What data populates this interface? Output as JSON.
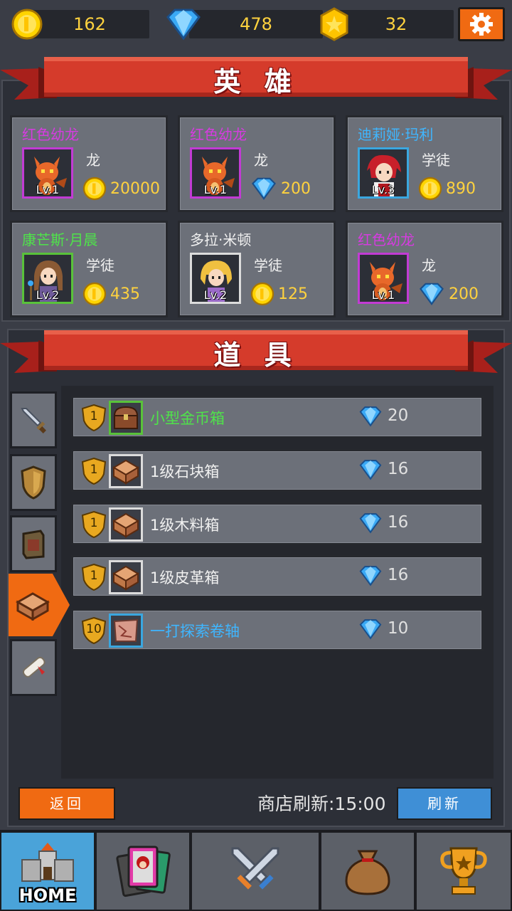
{
  "currencies": [
    {
      "icon": "gold-coin-icon",
      "value": "162"
    },
    {
      "icon": "diamond-icon",
      "value": "478"
    },
    {
      "icon": "star-coin-icon",
      "value": "32"
    }
  ],
  "heroes_section": {
    "title": "英 雄",
    "cards": [
      {
        "name": "红色幼龙",
        "name_color": "#d63be0",
        "role": "龙",
        "level": "Lv.1",
        "frame_color": "#c23bd4",
        "currency": "gold-coin-icon",
        "price": "20000",
        "portrait": "dragon"
      },
      {
        "name": "红色幼龙",
        "name_color": "#d63be0",
        "role": "龙",
        "level": "Lv.1",
        "frame_color": "#c23bd4",
        "currency": "diamond-icon",
        "price": "200",
        "portrait": "dragon"
      },
      {
        "name": "迪莉娅·玛利",
        "name_color": "#3fb6ff",
        "role": "学徒",
        "level": "Lv.3",
        "frame_color": "#3aa7e0",
        "currency": "gold-coin-icon",
        "price": "890",
        "portrait": "red-hair"
      },
      {
        "name": "康芒斯·月晨",
        "name_color": "#4fe34a",
        "role": "学徒",
        "level": "Lv.2",
        "frame_color": "#59c23a",
        "currency": "gold-coin-icon",
        "price": "435",
        "portrait": "brown-hair"
      },
      {
        "name": "多拉·米顿",
        "name_color": "#f0f0f0",
        "role": "学徒",
        "level": "Lv.2",
        "frame_color": "#dcdcdc",
        "currency": "gold-coin-icon",
        "price": "125",
        "portrait": "blonde"
      },
      {
        "name": "红色幼龙",
        "name_color": "#d63be0",
        "role": "龙",
        "level": "Lv.1",
        "frame_color": "#c23bd4",
        "currency": "diamond-icon",
        "price": "200",
        "portrait": "dragon"
      }
    ]
  },
  "items_section": {
    "title": "道 具",
    "tabs": [
      {
        "icon": "sword-icon",
        "active": false
      },
      {
        "icon": "shield-icon",
        "active": false
      },
      {
        "icon": "material-block-icon",
        "active": false
      },
      {
        "icon": "chest-icon",
        "active": true
      },
      {
        "icon": "scroll-icon",
        "active": false
      }
    ],
    "items": [
      {
        "badge": "1",
        "name": "小型金币箱",
        "name_color": "#4fe34a",
        "frame_color": "#59c23a",
        "icon": "treasure-chest-icon",
        "price": "20"
      },
      {
        "badge": "1",
        "name": "1级石块箱",
        "name_color": "#f0f0f0",
        "frame_color": "#dcdcdc",
        "icon": "crate-icon",
        "price": "16"
      },
      {
        "badge": "1",
        "name": "1级木料箱",
        "name_color": "#f0f0f0",
        "frame_color": "#dcdcdc",
        "icon": "crate-icon",
        "price": "16"
      },
      {
        "badge": "1",
        "name": "1级皮革箱",
        "name_color": "#f0f0f0",
        "frame_color": "#dcdcdc",
        "icon": "crate-icon",
        "price": "16"
      },
      {
        "badge": "10",
        "name": "一打探索卷轴",
        "name_color": "#3fb6ff",
        "frame_color": "#3aa7e0",
        "icon": "map-scroll-icon",
        "price": "10"
      }
    ]
  },
  "footer": {
    "back_label": "返回",
    "refresh_timer": "商店刷新:15:00",
    "refresh_label": "刷新"
  },
  "nav": {
    "home_label": "HOME",
    "items": [
      "castle-icon",
      "hero-cards-icon",
      "crossed-swords-icon",
      "loot-bag-icon",
      "trophy-icon"
    ]
  }
}
